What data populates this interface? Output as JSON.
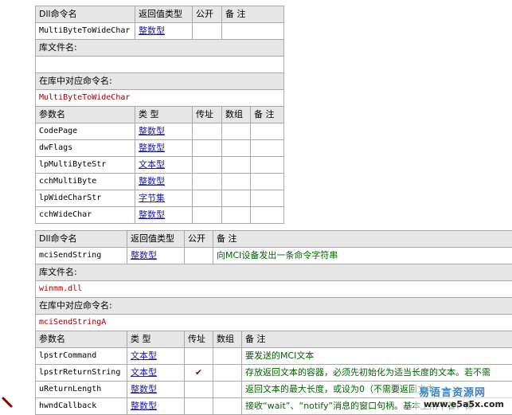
{
  "headers": {
    "dll_name": "Dll命令名",
    "ret_type": "返回值类型",
    "public": "公开",
    "note": "备 注",
    "lib_file": "库文件名:",
    "lib_cmd": "在库中对应命令名:",
    "param_name": "参数名",
    "type": "类 型",
    "byref": "传址",
    "array": "数组"
  },
  "block1": {
    "name": "MultiByteToWideChar",
    "ret": "整数型",
    "lib_value": "",
    "lib_cmd_value": "MultiByteToWideChar",
    "params": [
      {
        "name": "CodePage",
        "type": "整数型"
      },
      {
        "name": "dwFlags",
        "type": "整数型"
      },
      {
        "name": "lpMultiByteStr",
        "type": "文本型"
      },
      {
        "name": "cchMultiByte",
        "type": "整数型"
      },
      {
        "name": "lpWideCharStr",
        "type": "字节集"
      },
      {
        "name": "cchWideChar",
        "type": "整数型"
      }
    ]
  },
  "block2": {
    "name": "mciSendString",
    "ret": "整数型",
    "note": "向MCI设备发出一条命令字符串",
    "lib_value": "winmm.dll",
    "lib_cmd_value": "mciSendStringA",
    "params": [
      {
        "name": "lpstrCommand",
        "type": "文本型",
        "byref": "",
        "note": "要发送的MCI文本"
      },
      {
        "name": "lpstrReturnString",
        "type": "文本型",
        "byref": "✔",
        "note": "存放返回文本的容器，必须先初始化为适当长度的文本。若不需"
      },
      {
        "name": "uReturnLength",
        "type": "整数型",
        "byref": "",
        "note": "返回文本的最大长度，或设为0（不需要返回文本"
      },
      {
        "name": "hwndCallback",
        "type": "整数型",
        "byref": "",
        "note": "接收“wait”、“notify”消息的窗口句柄。基本上用不着，保"
      }
    ]
  },
  "watermark": {
    "title": "易语言资源网",
    "url": "www.e5a5x.com"
  }
}
